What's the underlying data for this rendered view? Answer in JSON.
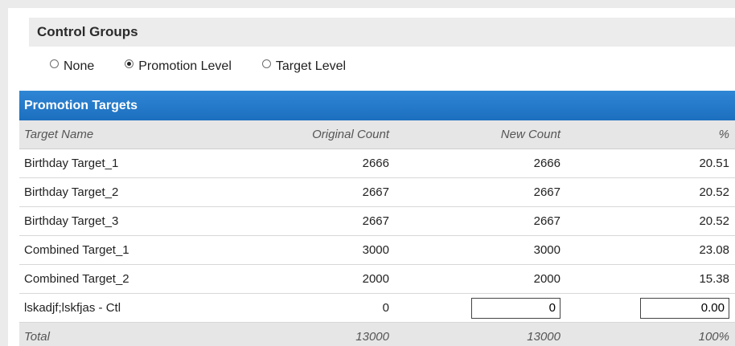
{
  "control_groups": {
    "title": "Control Groups",
    "options": [
      {
        "label": "None",
        "checked": false
      },
      {
        "label": "Promotion Level",
        "checked": true
      },
      {
        "label": "Target Level",
        "checked": false
      }
    ]
  },
  "promotion_targets": {
    "title": "Promotion Targets",
    "columns": [
      "Target Name",
      "Original Count",
      "New Count",
      "%"
    ],
    "rows": [
      {
        "name": "Birthday Target_1",
        "original": "2666",
        "new": "2666",
        "pct": "20.51"
      },
      {
        "name": "Birthday Target_2",
        "original": "2667",
        "new": "2667",
        "pct": "20.52"
      },
      {
        "name": "Birthday Target_3",
        "original": "2667",
        "new": "2667",
        "pct": "20.52"
      },
      {
        "name": "Combined Target_1",
        "original": "3000",
        "new": "3000",
        "pct": "23.08"
      },
      {
        "name": "Combined Target_2",
        "original": "2000",
        "new": "2000",
        "pct": "15.38"
      },
      {
        "name": "lskadjf;lskfjas - Ctl",
        "original": "0",
        "new": "0",
        "pct": "0.00"
      }
    ],
    "total": {
      "label": "Total",
      "original": "13000",
      "new": "13000",
      "pct": "100%"
    }
  }
}
